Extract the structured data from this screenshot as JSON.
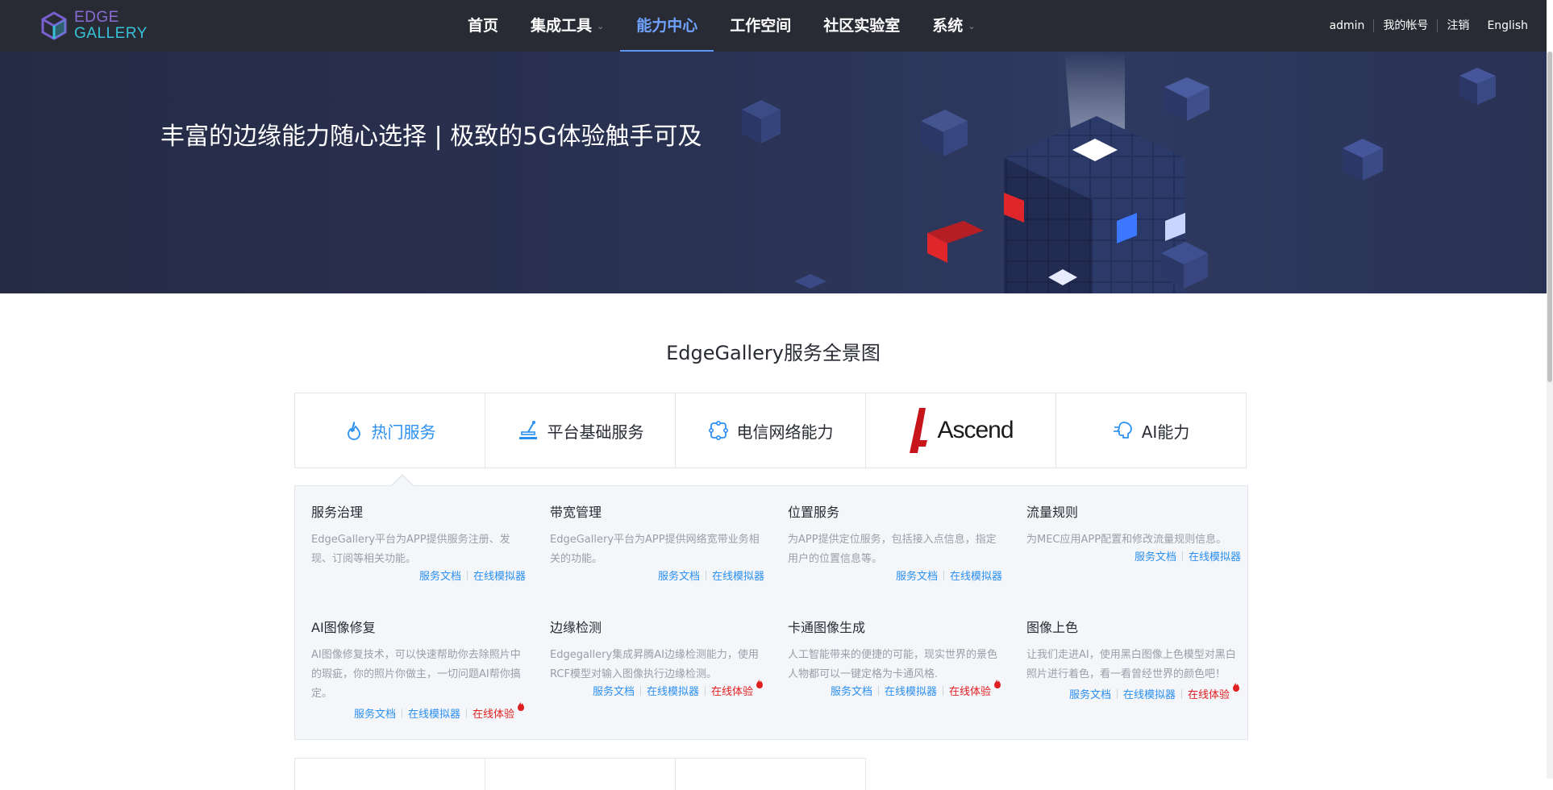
{
  "header": {
    "logo_line1": "EDGE",
    "logo_line2": "GALLERY",
    "nav": [
      {
        "label": "首页",
        "has_dropdown": false,
        "active": false
      },
      {
        "label": "集成工具",
        "has_dropdown": true,
        "active": false
      },
      {
        "label": "能力中心",
        "has_dropdown": false,
        "active": true
      },
      {
        "label": "工作空间",
        "has_dropdown": false,
        "active": false
      },
      {
        "label": "社区实验室",
        "has_dropdown": false,
        "active": false
      },
      {
        "label": "系统",
        "has_dropdown": true,
        "active": false
      }
    ],
    "user": "admin",
    "account": "我的帐号",
    "logout": "注销",
    "language": "English"
  },
  "banner": {
    "title": "丰富的边缘能力随心选择 | 极致的5G体验触手可及"
  },
  "section_title": "EdgeGallery服务全景图",
  "tabs": [
    {
      "label": "热门服务",
      "icon": "fire-icon",
      "active": true
    },
    {
      "label": "平台基础服务",
      "icon": "platform-icon",
      "active": false
    },
    {
      "label": "电信网络能力",
      "icon": "network-icon",
      "active": false
    },
    {
      "label": "Ascend",
      "icon": "ascend-logo",
      "active": false
    },
    {
      "label": "AI能力",
      "icon": "ai-icon",
      "active": false
    }
  ],
  "cards": [
    {
      "title": "服务治理",
      "desc": "EdgeGallery平台为APP提供服务注册、发现、订阅等相关功能。",
      "doc": "服务文档",
      "sim": "在线模拟器"
    },
    {
      "title": "带宽管理",
      "desc": "EdgeGallery平台为APP提供网络宽带业务相关的功能。",
      "doc": "服务文档",
      "sim": "在线模拟器"
    },
    {
      "title": "位置服务",
      "desc": "为APP提供定位服务，包括接入点信息，指定用户的位置信息等。",
      "doc": "服务文档",
      "sim": "在线模拟器"
    },
    {
      "title": "流量规则",
      "desc": "为MEC应用APP配置和修改流量规则信息。",
      "doc": "服务文档",
      "sim": "在线模拟器"
    },
    {
      "title": "AI图像修复",
      "desc": "AI图像修复技术，可以快速帮助你去除照片中的瑕疵，你的照片你做主，一切问题AI帮你搞定。",
      "doc": "服务文档",
      "sim": "在线模拟器",
      "try": "在线体验"
    },
    {
      "title": "边缘检测",
      "desc": "Edgegallery集成昇腾AI边缘检测能力，使用RCF模型对输入图像执行边缘检测。",
      "doc": "服务文档",
      "sim": "在线模拟器",
      "try": "在线体验"
    },
    {
      "title": "卡通图像生成",
      "desc": "人工智能带来的便捷的可能，现实世界的景色人物都可以一键定格为卡通风格.",
      "doc": "服务文档",
      "sim": "在线模拟器",
      "try": "在线体验"
    },
    {
      "title": "图像上色",
      "desc": "让我们走进AI，使用黑白图像上色模型对黑白照片进行着色，看一看曾经世界的颜色吧！",
      "doc": "服务文档",
      "sim": "在线模拟器",
      "try": "在线体验"
    }
  ],
  "colors": {
    "nav_bg": "#282b33",
    "accent": "#2b8ff0",
    "hot": "#e02020",
    "panel_bg": "#f4f6f9"
  }
}
